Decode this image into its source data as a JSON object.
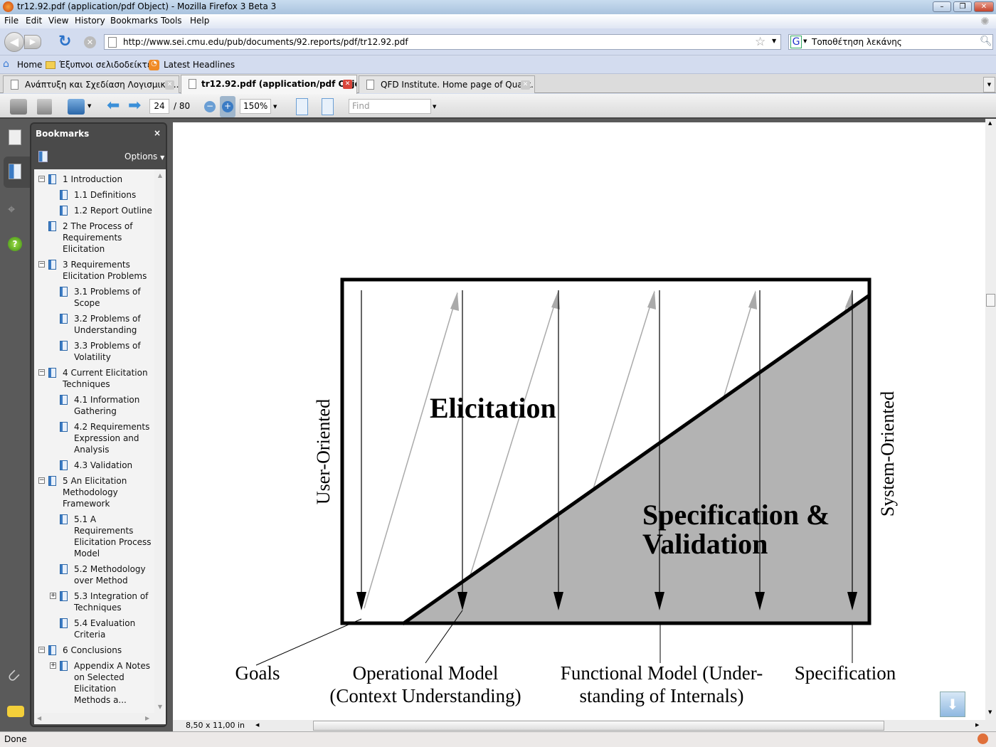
{
  "window": {
    "title": "tr12.92.pdf (application/pdf Object) - Mozilla Firefox 3 Beta 3"
  },
  "menu": [
    "File",
    "Edit",
    "View",
    "History",
    "Bookmarks",
    "Tools",
    "Help"
  ],
  "nav": {
    "url": "http://www.sei.cmu.edu/pub/documents/92.reports/pdf/tr12.92.pdf",
    "search_value": "Τοποθέτηση λεκάνης"
  },
  "bookmarks_bar": [
    "Home",
    "Έξυπνοι σελιδοδείκτες",
    "Latest Headlines"
  ],
  "tabs": [
    {
      "label": "Ανάπτυξη και Σχεδίαση Λογισμικο...",
      "active": false
    },
    {
      "label": "tr12.92.pdf (application/pdf Obje...",
      "active": true
    },
    {
      "label": "QFD Institute. Home page of Qualit...",
      "active": false
    }
  ],
  "pdf_toolbar": {
    "page": "24",
    "total": "/ 80",
    "zoom": "150%",
    "find_placeholder": "Find"
  },
  "sidebar": {
    "title": "Bookmarks",
    "options": "Options",
    "items": [
      {
        "label": "1 Introduction",
        "level": 0,
        "toggle": "minus"
      },
      {
        "label": "1.1 Definitions",
        "level": 1
      },
      {
        "label": "1.2 Report Outline",
        "level": 1
      },
      {
        "label": "2 The Process of Requirements Elicitation",
        "level": 0
      },
      {
        "label": "3 Requirements Elicitation Problems",
        "level": 0,
        "toggle": "minus"
      },
      {
        "label": "3.1 Problems of Scope",
        "level": 1
      },
      {
        "label": "3.2 Problems of Understanding",
        "level": 1
      },
      {
        "label": "3.3 Problems of Volatility",
        "level": 1
      },
      {
        "label": "4 Current Elicitation Techniques",
        "level": 0,
        "toggle": "minus"
      },
      {
        "label": "4.1 Information Gathering",
        "level": 1
      },
      {
        "label": "4.2 Requirements Expression and Analysis",
        "level": 1
      },
      {
        "label": "4.3 Validation",
        "level": 1
      },
      {
        "label": "5 An Elicitation Methodology Framework",
        "level": 0,
        "toggle": "minus"
      },
      {
        "label": "5.1 A Requirements Elicitation Process Model",
        "level": 1
      },
      {
        "label": "5.2 Methodology over Method",
        "level": 1
      },
      {
        "label": "5.3 Integration of Techniques",
        "level": 1,
        "toggle": "plus"
      },
      {
        "label": "5.4 Evaluation Criteria",
        "level": 1
      },
      {
        "label": "6 Conclusions",
        "level": 0,
        "toggle": "minus"
      },
      {
        "label": "Appendix A Notes on Selected Elicitation Methods a...",
        "level": 1,
        "toggle": "plus"
      }
    ]
  },
  "diagram": {
    "elicitation": "Elicitation",
    "spec1": "Specification &",
    "spec2": "Validation",
    "left": "User-Oriented",
    "right": "System-Oriented",
    "labels": {
      "goals": "Goals",
      "op1": "Operational Model",
      "op2": "(Context Understanding)",
      "fn1": "Functional Model (Under-",
      "fn2": "standing of Internals)",
      "spec": "Specification"
    }
  },
  "page_size": "8,50 x 11,00 in",
  "status": "Done"
}
